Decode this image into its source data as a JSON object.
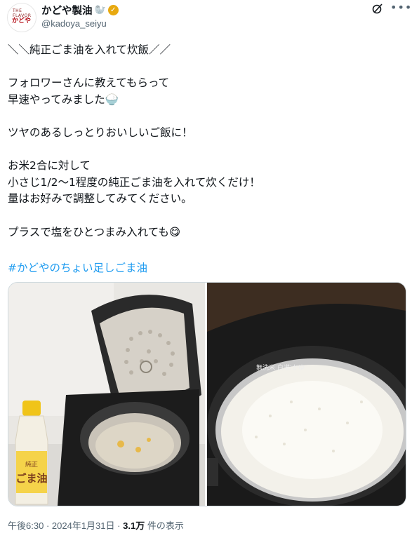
{
  "account": {
    "avatar_small_text": "THE FLAVOR",
    "avatar_logo_text": "かどや",
    "display_name": "かどや製油",
    "display_name_emoji": "🦭",
    "handle": "@kadoya_seiyu",
    "verified_icon": "check-badge-icon"
  },
  "post": {
    "lines": [
      "＼＼純正ごま油を入れて炊飯／／",
      "",
      "フォロワーさんに教えてもらって",
      "早速やってみました🍚",
      "",
      "ツヤのあるしっとりおいしいご飯に！",
      "",
      "お米2合に対して",
      "小さじ1/2〜1程度の純正ごま油を入れて炊くだけ！",
      "量はお好みで調整してみてください。",
      "",
      "プラスで塩をひとつまみ入れても😋"
    ],
    "hashtag": "#かどやのちょい足しごま油"
  },
  "media": {
    "photo_1_bottle_label": "ごま油",
    "photo_1_bottle_sub": "純正",
    "photo_2_pot_label": "無洗米 白米",
    "photo_2_pot_label_2": "おかゆ"
  },
  "meta": {
    "time": "午後6:30",
    "sep": "·",
    "date": "2024年1月31日",
    "views_count": "3.1万",
    "views_label": "件の表示"
  },
  "colors": {
    "link": "#1d9bf0",
    "muted": "#536471",
    "verified": "#e8a90f"
  }
}
